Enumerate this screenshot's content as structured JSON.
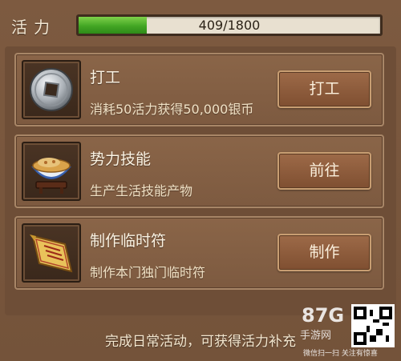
{
  "energy": {
    "label": "活力",
    "current": 409,
    "max": 1800,
    "text": "409/1800",
    "fill_fraction": 0.227
  },
  "activities": [
    {
      "title": "打工",
      "description": "消耗50活力获得50,000银币",
      "button_label": "打工",
      "icon": "silver-coin-icon"
    },
    {
      "title": "势力技能",
      "description": "生产生活技能产物",
      "button_label": "前往",
      "icon": "porcelain-bowl-icon"
    },
    {
      "title": "制作临时符",
      "description": "制作本门独门临时符",
      "button_label": "制作",
      "icon": "talisman-scroll-icon"
    }
  ],
  "footer": {
    "note": "完成日常活动，可获得活力补充"
  },
  "watermark": {
    "logo": "87G",
    "sub": "手游网",
    "caption": "微信扫一扫 关注有惊喜"
  },
  "colors": {
    "background": "#7a573d",
    "bar_fill": "#43a624",
    "button": "#8f5d3d"
  }
}
